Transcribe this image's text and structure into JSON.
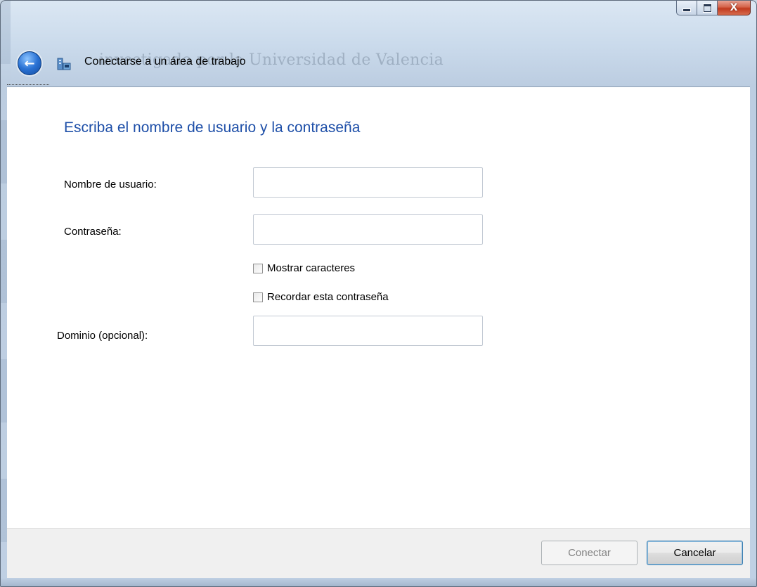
{
  "window": {
    "title": "Conectarse a un área de trabajo",
    "background_ghost_text": "investigado por la Universidad de Valencia"
  },
  "caption_buttons": {
    "minimize_icon": "minimize-icon",
    "maximize_icon": "maximize-icon",
    "close_icon": "close-icon",
    "close_glyph": "X"
  },
  "nav": {
    "back_icon": "back-arrow-icon",
    "back_glyph": "←",
    "app_icon": "network-workplace-icon"
  },
  "form": {
    "heading": "Escriba el nombre de usuario y la contraseña",
    "username_label": "Nombre de usuario:",
    "username_value": "",
    "password_label": "Contraseña:",
    "password_value": "",
    "show_chars_label": "Mostrar caracteres",
    "show_chars_checked": false,
    "remember_label": "Recordar esta contraseña",
    "remember_checked": false,
    "domain_label": "Dominio (opcional):",
    "domain_value": ""
  },
  "footer": {
    "connect_label": "Conectar",
    "connect_enabled": false,
    "cancel_label": "Cancelar"
  },
  "colors": {
    "heading": "#1e4fa8",
    "close_button": "#c13a1e",
    "footer_bg": "#f0f0f0"
  }
}
